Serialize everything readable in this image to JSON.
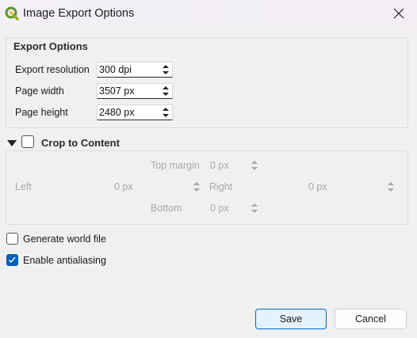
{
  "window": {
    "title": "Image Export Options",
    "app_icon": "qgis-icon",
    "close_icon": "close-icon"
  },
  "export_options": {
    "title": "Export Options",
    "resolution_label": "Export resolution",
    "resolution_value": "300 dpi",
    "width_label": "Page width",
    "width_value": "3507 px",
    "height_label": "Page height",
    "height_value": "2480 px"
  },
  "crop": {
    "title": "Crop to Content",
    "checked": false,
    "expanded": true,
    "top_label": "Top margin",
    "top_value": "0 px",
    "left_label": "Left",
    "left_value": "0 px",
    "right_label": "Right",
    "right_value": "0 px",
    "bottom_label": "Bottom",
    "bottom_value": "0 px"
  },
  "options": {
    "world_file_label": "Generate world file",
    "world_file_checked": false,
    "antialias_label": "Enable antialiasing",
    "antialias_checked": true
  },
  "buttons": {
    "save_label": "Save",
    "cancel_label": "Cancel"
  },
  "colors": {
    "accent": "#005fb8",
    "save_border": "#0067c0",
    "save_bg": "#e5f1fb",
    "disabled_text": "#a8a8a8"
  }
}
